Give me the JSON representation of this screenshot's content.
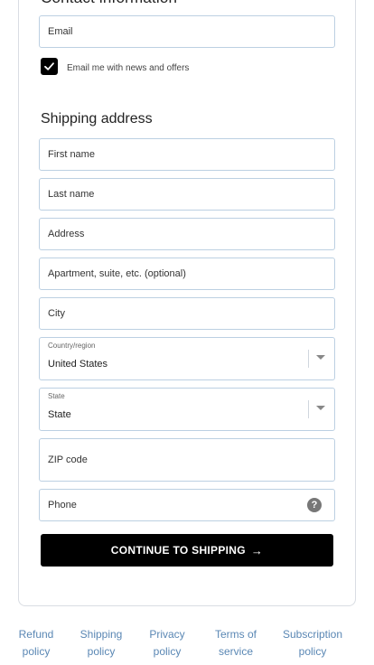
{
  "contact": {
    "heading": "Contact information",
    "email_placeholder": "Email",
    "newsletter_label": "Email me with news and offers",
    "newsletter_checked": true
  },
  "shipping": {
    "heading": "Shipping address",
    "first_name_placeholder": "First name",
    "last_name_placeholder": "Last name",
    "address_placeholder": "Address",
    "apartment_placeholder": "Apartment, suite, etc. (optional)",
    "city_placeholder": "City",
    "country_label": "Country/region",
    "country_value": "United States",
    "state_label": "State",
    "state_value": "State",
    "zip_placeholder": "ZIP code",
    "phone_placeholder": "Phone",
    "help_glyph": "?"
  },
  "actions": {
    "continue_label": "CONTINUE TO SHIPPING",
    "continue_arrow": "→"
  },
  "footer": {
    "links": [
      {
        "line1": "Refund",
        "line2": "policy"
      },
      {
        "line1": "Shipping",
        "line2": "policy"
      },
      {
        "line1": "Privacy",
        "line2": "policy"
      },
      {
        "line1": "Terms of",
        "line2": "service"
      },
      {
        "line1": "Subscription",
        "line2": "policy"
      }
    ]
  },
  "colors": {
    "field_border": "#bcd0e2",
    "button_bg": "#000000",
    "link": "#5a87b4"
  },
  "icons": {
    "checkbox": "checkmark-icon",
    "select": "chevron-down-icon",
    "phone_help": "question-circle-icon",
    "button": "arrow-right-icon"
  }
}
